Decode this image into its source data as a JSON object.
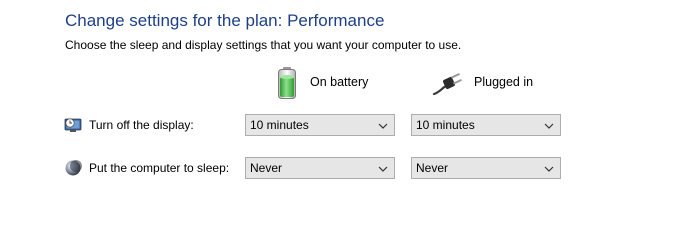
{
  "header": {
    "title": "Change settings for the plan: Performance",
    "subtitle": "Choose the sleep and display settings that you want your computer to use."
  },
  "columns": {
    "battery": {
      "label": "On battery",
      "icon": "battery-icon"
    },
    "plugged": {
      "label": "Plugged in",
      "icon": "power-plug-icon"
    }
  },
  "rows": {
    "display": {
      "label": "Turn off the display:",
      "icon": "monitor-clock-icon",
      "battery_value": "10 minutes",
      "plugged_value": "10 minutes"
    },
    "sleep": {
      "label": "Put the computer to sleep:",
      "icon": "moon-sleep-icon",
      "battery_value": "Never",
      "plugged_value": "Never"
    }
  },
  "colors": {
    "title": "#1e3f87",
    "dropdown_bg": "#e6e6e6",
    "dropdown_border": "#adadad",
    "battery_green": "#3cb43c"
  }
}
